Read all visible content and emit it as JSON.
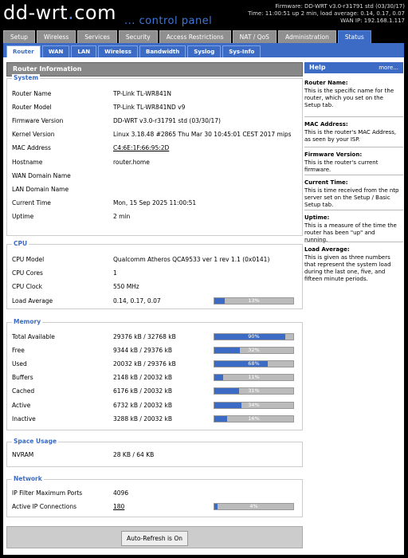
{
  "header": {
    "logo_main": "dd-wrt",
    "logo_dot": ".",
    "logo_tld": "com",
    "control_panel": "... control panel",
    "firmware": "Firmware: DD-WRT v3.0-r31791 std (03/30/17)",
    "time": "Time: 11:00:51 up 2 min, load average: 0.14, 0.17, 0.07",
    "wan_ip": "WAN IP: 192.168.1.117"
  },
  "main_tabs": [
    "Setup",
    "Wireless",
    "Services",
    "Security",
    "Access Restrictions",
    "NAT / QoS",
    "Administration",
    "Status"
  ],
  "main_tab_active": 7,
  "sub_tabs": [
    "Router",
    "WAN",
    "LAN",
    "Wireless",
    "Bandwidth",
    "Syslog",
    "Sys-Info"
  ],
  "sub_tab_active": 0,
  "page_title": "Router Information",
  "system": {
    "legend": "System",
    "rows": [
      {
        "label": "Router Name",
        "value": "TP-Link TL-WR841N"
      },
      {
        "label": "Router Model",
        "value": "TP-Link TL-WR841ND v9"
      },
      {
        "label": "Firmware Version",
        "value": "DD-WRT v3.0-r31791 std (03/30/17)"
      },
      {
        "label": "Kernel Version",
        "value": "Linux 3.18.48 #2865 Thu Mar 30 10:45:01 CEST 2017 mips"
      },
      {
        "label": "MAC Address",
        "value": "C4:6E:1F:66:95:2D"
      },
      {
        "label": "Hostname",
        "value": "router.home"
      },
      {
        "label": "WAN Domain Name",
        "value": ""
      },
      {
        "label": "LAN Domain Name",
        "value": ""
      },
      {
        "label": "Current Time",
        "value": "Mon, 15 Sep 2025 11:00:51"
      },
      {
        "label": "Uptime",
        "value": "2 min"
      }
    ]
  },
  "cpu": {
    "legend": "CPU",
    "rows": [
      {
        "label": "CPU Model",
        "value": "Qualcomm Atheros QCA9533 ver 1 rev 1.1 (0x0141)"
      },
      {
        "label": "CPU Cores",
        "value": "1"
      },
      {
        "label": "CPU Clock",
        "value": "550 MHz"
      },
      {
        "label": "Load Average",
        "value": "0.14, 0.17, 0.07",
        "percent": 13,
        "percent_label": "13%"
      }
    ]
  },
  "memory": {
    "legend": "Memory",
    "rows": [
      {
        "label": "Total Available",
        "value": "29376 kB / 32768 kB",
        "percent": 90,
        "percent_label": "90%"
      },
      {
        "label": "Free",
        "value": "9344 kB / 29376 kB",
        "percent": 32,
        "percent_label": "32%"
      },
      {
        "label": "Used",
        "value": "20032 kB / 29376 kB",
        "percent": 68,
        "percent_label": "68%"
      },
      {
        "label": "Buffers",
        "value": "2148 kB / 20032 kB",
        "percent": 11,
        "percent_label": "11%"
      },
      {
        "label": "Cached",
        "value": "6176 kB / 20032 kB",
        "percent": 31,
        "percent_label": "31%"
      },
      {
        "label": "Active",
        "value": "6732 kB / 20032 kB",
        "percent": 34,
        "percent_label": "34%"
      },
      {
        "label": "Inactive",
        "value": "3288 kB / 20032 kB",
        "percent": 16,
        "percent_label": "16%"
      }
    ]
  },
  "space": {
    "legend": "Space Usage",
    "rows": [
      {
        "label": "NVRAM",
        "value": "28 KB / 64 KB"
      }
    ]
  },
  "network": {
    "legend": "Network",
    "rows": [
      {
        "label": "IP Filter Maximum Ports",
        "value": "4096"
      },
      {
        "label": "Active IP Connections",
        "value": "180",
        "percent": 4,
        "percent_label": "4%"
      }
    ]
  },
  "auto_refresh_label": "Auto-Refresh is On",
  "help": {
    "title": "Help",
    "more": "more...",
    "items": [
      {
        "title": "Router Name:",
        "text": "This is the specific name for the router, which you set on the Setup tab."
      },
      {
        "title": "MAC Address:",
        "text": "This is the router's MAC Address, as seen by your ISP."
      },
      {
        "title": "Firmware Version:",
        "text": "This is the router's current firmware."
      },
      {
        "title": "Current Time:",
        "text": "This is time received from the ntp server set on the Setup / Basic Setup tab."
      },
      {
        "title": "Uptime:",
        "text": "This is a measure of the time the router has been \"up\" and running."
      },
      {
        "title": "Load Average:",
        "text": "This is given as three numbers that represent the system load during the last one, five, and fifteen minute periods."
      }
    ]
  },
  "colors": {
    "accent": "#3b6bc4",
    "tab_inactive": "#8f8f8f",
    "bar_bg": "#bbbbbb"
  }
}
